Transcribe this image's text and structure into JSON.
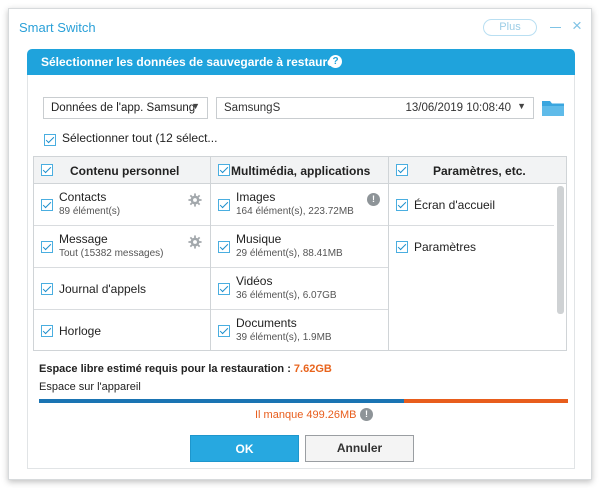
{
  "window": {
    "title": "Smart Switch",
    "plus_label": "Plus",
    "close_glyph": "×"
  },
  "dialog": {
    "title": "Sélectionner les données de sauvegarde à restaurer",
    "help_glyph": "?",
    "app_select": {
      "value": "Données de l'app. Samsung"
    },
    "backup_select": {
      "name": "SamsungS",
      "date": "13/06/2019 10:08:40"
    },
    "select_all_label": "Sélectionner tout (12 sélect..."
  },
  "columns": [
    {
      "header": "Contenu personnel",
      "items": [
        {
          "title": "Contacts",
          "sub": "89 élément(s)",
          "icon": "gear-icon"
        },
        {
          "title": "Message",
          "sub": "Tout (15382 messages)",
          "icon": "gear-icon"
        },
        {
          "title": "Journal d'appels"
        },
        {
          "title": "Horloge"
        }
      ]
    },
    {
      "header": "Multimédia, applications",
      "items": [
        {
          "title": "Images",
          "sub": "164 élément(s), 223.72MB",
          "icon": "info-icon"
        },
        {
          "title": "Musique",
          "sub": "29 élément(s), 88.41MB"
        },
        {
          "title": "Vidéos",
          "sub": "36 élément(s), 6.07GB"
        },
        {
          "title": "Documents",
          "sub": "39 élément(s), 1.9MB"
        }
      ]
    },
    {
      "header": "Paramètres, etc.",
      "items": [
        {
          "title": "Écran d'accueil"
        },
        {
          "title": "Paramètres"
        }
      ]
    }
  ],
  "storage": {
    "required_label": "Espace libre estimé requis pour la restauration : ",
    "required_value": "7.62GB",
    "device_label": "Espace sur l'appareil",
    "available_fraction": 0.69,
    "missing_text": "Il manque 499.26MB",
    "info_glyph": "!"
  },
  "buttons": {
    "ok": "OK",
    "cancel": "Annuler"
  },
  "colors": {
    "accent": "#1fa3dc",
    "warning": "#e8641d",
    "available": "#1a74b3"
  }
}
